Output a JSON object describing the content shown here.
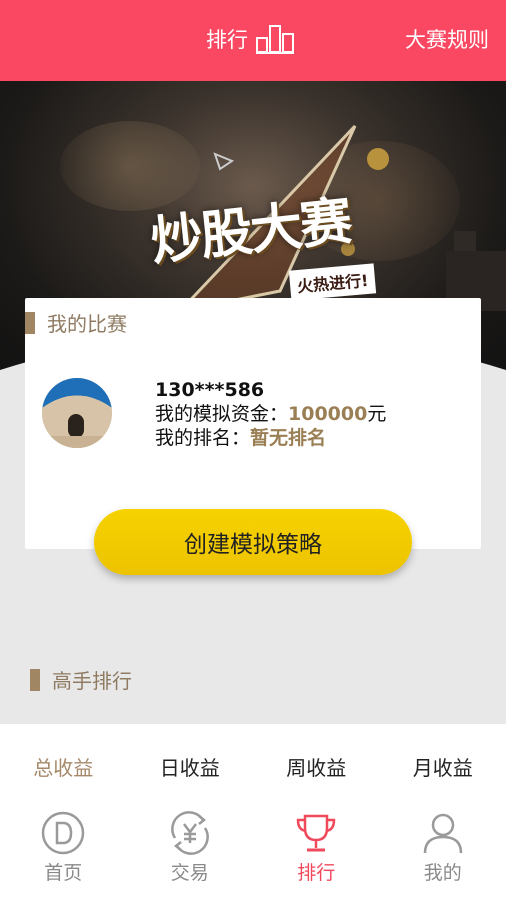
{
  "header": {
    "title": "排行",
    "rules_label": "大赛规则"
  },
  "banner": {
    "headline": "炒股大赛",
    "tag": "火热进行!"
  },
  "my_competition": {
    "section_title": "我的比赛",
    "user_phone": "130***586",
    "funds_label": "我的模拟资金：",
    "funds_value": "100000",
    "funds_unit": "元",
    "rank_label": "我的排名：",
    "rank_value": "暂无排名",
    "create_button": "创建模拟策略"
  },
  "masters": {
    "section_title": "高手排行"
  },
  "tabs": [
    {
      "label": "总收益",
      "active": true
    },
    {
      "label": "日收益",
      "active": false
    },
    {
      "label": "周收益",
      "active": false
    },
    {
      "label": "月收益",
      "active": false
    }
  ],
  "bottom_nav": [
    {
      "label": "首页",
      "icon": "home-d-icon",
      "active": false
    },
    {
      "label": "交易",
      "icon": "yuan-cycle-icon",
      "active": false
    },
    {
      "label": "排行",
      "icon": "trophy-icon",
      "active": true
    },
    {
      "label": "我的",
      "icon": "user-icon",
      "active": false
    }
  ],
  "colors": {
    "header_bg": "#fb4862",
    "accent_gold": "#a08662",
    "button_yellow": "#f6d200",
    "nav_active": "#f0495c"
  }
}
